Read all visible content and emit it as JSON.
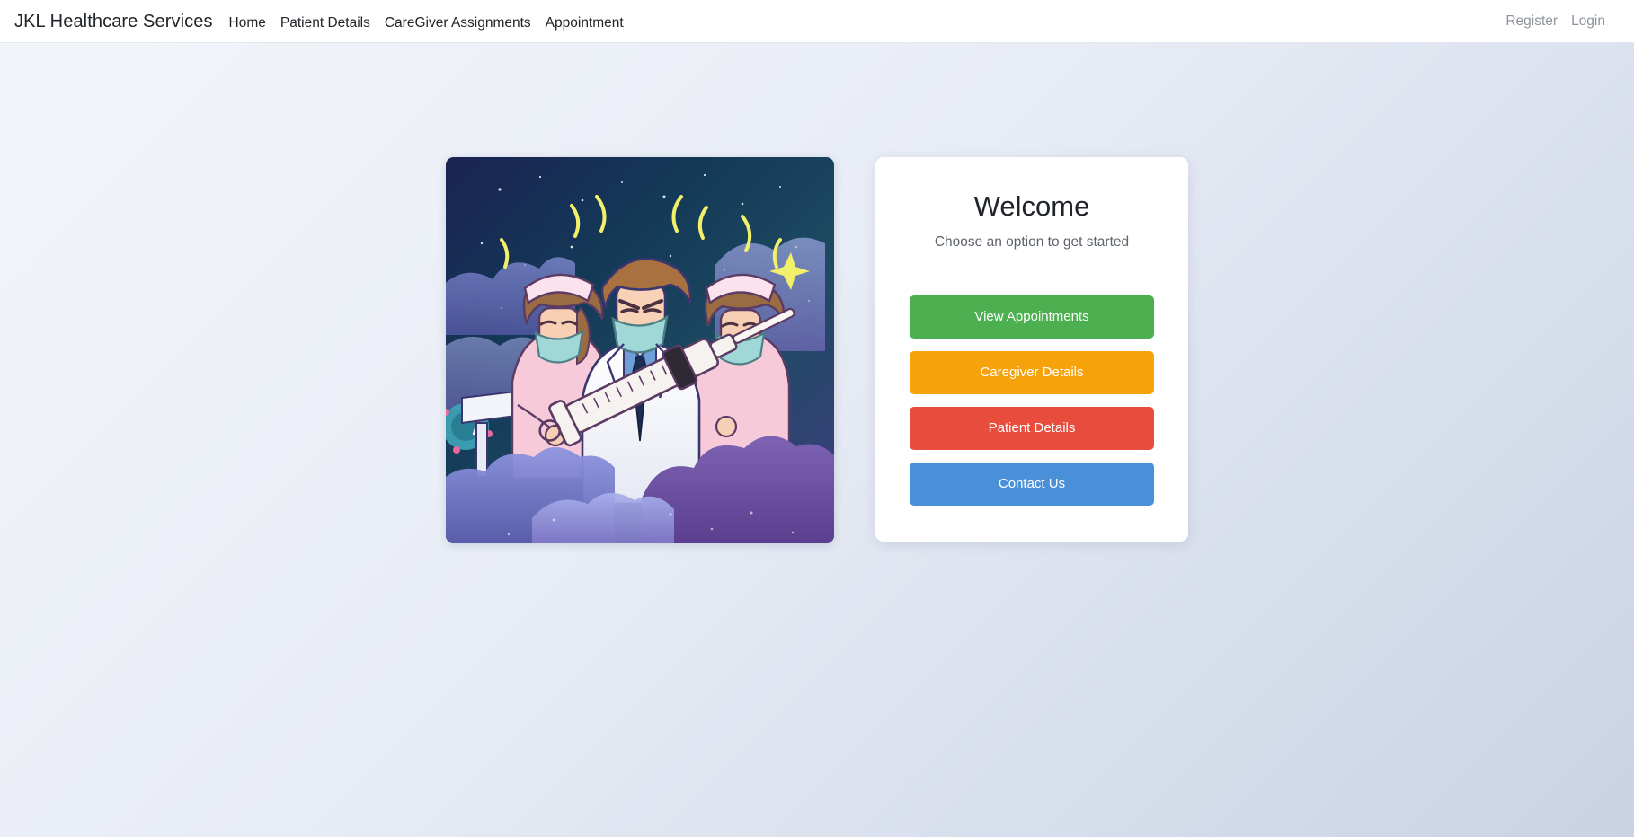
{
  "navbar": {
    "brand": "JKL Healthcare Services",
    "links": [
      {
        "label": "Home"
      },
      {
        "label": "Patient Details"
      },
      {
        "label": "CareGiver Assignments"
      },
      {
        "label": "Appointment"
      }
    ],
    "auth": [
      {
        "label": "Register"
      },
      {
        "label": "Login"
      }
    ]
  },
  "hero": {
    "image_alt": "Illustration of three masked medical workers holding a large syringe against a purple night sky with clouds"
  },
  "card": {
    "title": "Welcome",
    "subtitle": "Choose an option to get started",
    "buttons": [
      {
        "label": "View Appointments",
        "color": "#4caf50"
      },
      {
        "label": "Caregiver Details",
        "color": "#f5a20b"
      },
      {
        "label": "Patient Details",
        "color": "#e74c3c"
      },
      {
        "label": "Contact Us",
        "color": "#4a90d9"
      }
    ]
  }
}
